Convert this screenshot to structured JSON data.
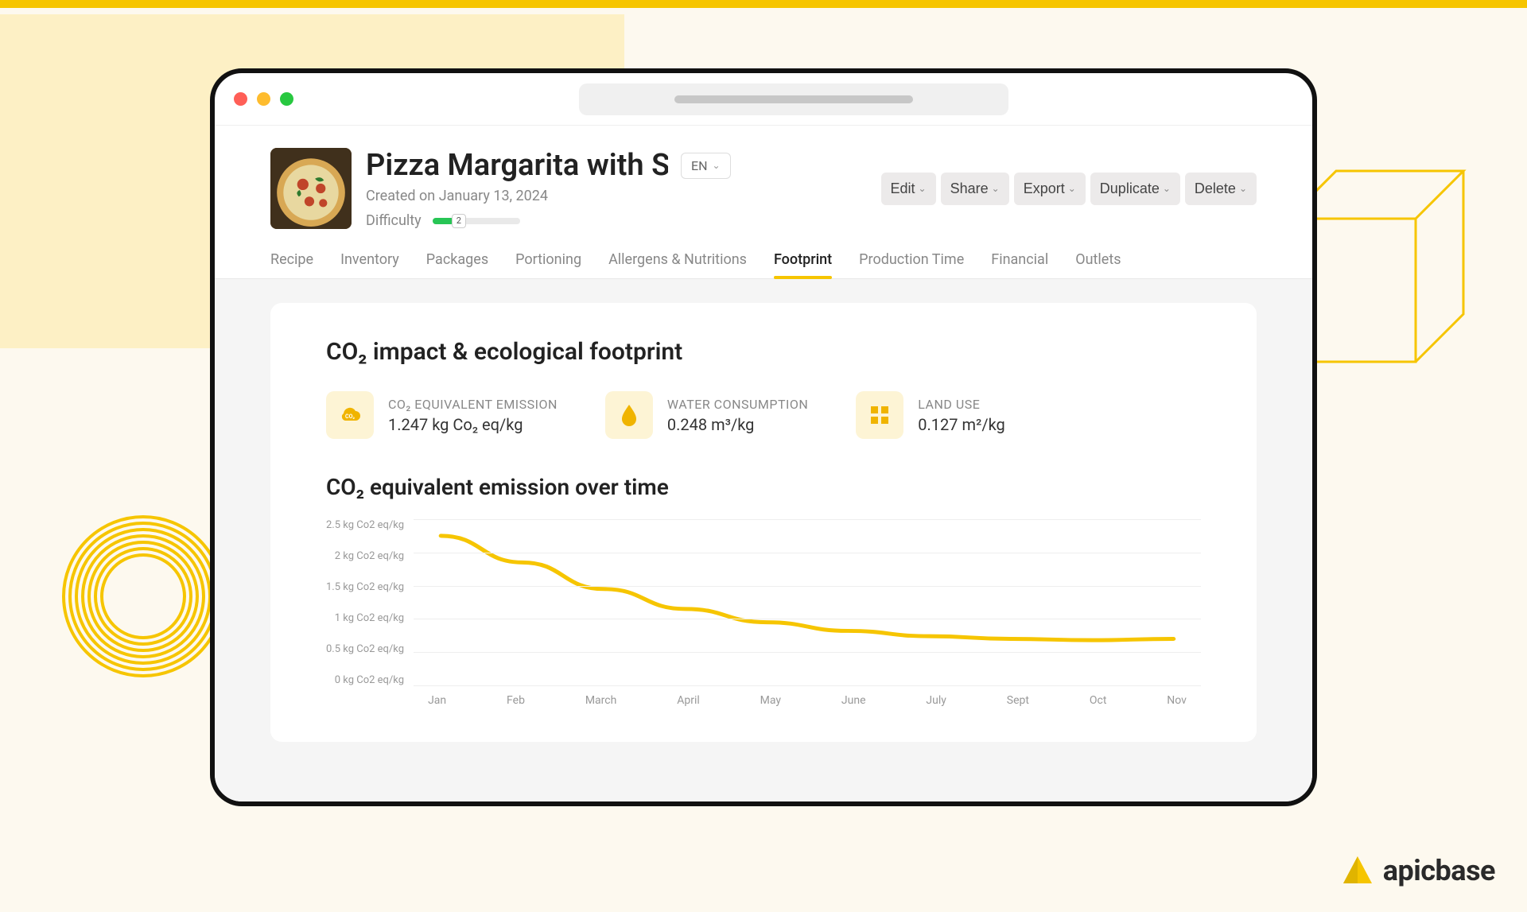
{
  "brand": {
    "name": "apicbase"
  },
  "header": {
    "title": "Pizza Margarita with S…",
    "lang": "EN",
    "created": "Created on January 13, 2024",
    "difficulty_label": "Difficulty",
    "difficulty_value": "2"
  },
  "actions": {
    "edit": "Edit",
    "share": "Share",
    "export": "Export",
    "duplicate": "Duplicate",
    "delete": "Delete"
  },
  "tabs": {
    "recipe": "Recipe",
    "inventory": "Inventory",
    "packages": "Packages",
    "portioning": "Portioning",
    "allergens": "Allergens & Nutritions",
    "footprint": "Footprint",
    "production": "Production Time",
    "financial": "Financial",
    "outlets": "Outlets"
  },
  "footprint": {
    "section_title": "CO₂ impact & ecological footprint",
    "metrics": {
      "co2": {
        "label": "CO₂ EQUIVALENT EMISSION",
        "value": "1.247 kg Co₂ eq/kg"
      },
      "water": {
        "label": "WATER CONSUMPTION",
        "value": "0.248 m³/kg"
      },
      "land": {
        "label": "LAND USE",
        "value": "0.127 m²/kg"
      }
    },
    "chart_title": "CO₂ equivalent emission over time"
  },
  "chart_data": {
    "type": "line",
    "title": "CO₂ equivalent emission over time",
    "xlabel": "",
    "ylabel": "kg Co2 eq/kg",
    "ylim": [
      0,
      2.5
    ],
    "y_ticks": [
      "2.5 kg Co2 eq/kg",
      "2 kg Co2 eq/kg",
      "1.5 kg Co2 eq/kg",
      "1 kg Co2 eq/kg",
      "0.5 kg Co2 eq/kg",
      "0 kg Co2 eq/kg"
    ],
    "categories": [
      "Jan",
      "Feb",
      "March",
      "April",
      "May",
      "June",
      "July",
      "Sept",
      "Oct",
      "Nov"
    ],
    "series": [
      {
        "name": "CO2 eq",
        "values": [
          2.25,
          1.85,
          1.45,
          1.15,
          0.95,
          0.82,
          0.74,
          0.7,
          0.68,
          0.7
        ]
      }
    ]
  }
}
